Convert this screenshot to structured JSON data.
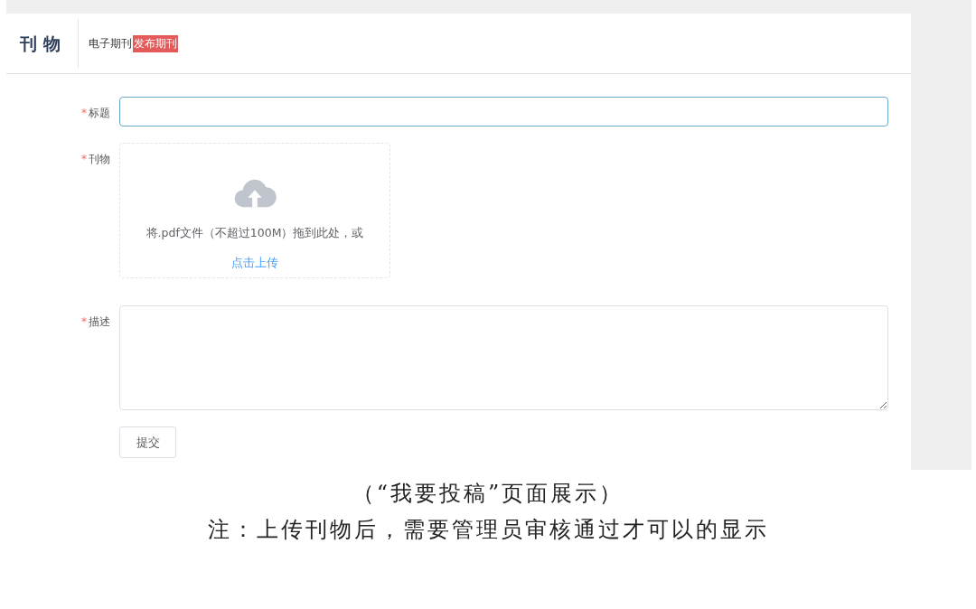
{
  "header": {
    "title": "刊 物",
    "breadcrumb": [
      {
        "label": "电子期刊",
        "highlighted": false
      },
      {
        "label": "发布期刊",
        "highlighted": true
      }
    ]
  },
  "form": {
    "fields": [
      {
        "kind": "input",
        "required_mark": "*",
        "label": "标题",
        "focused": true
      },
      {
        "kind": "upload",
        "required_mark": "*",
        "label": "刊物",
        "hint": "将.pdf文件（不超过100M）拖到此处，或 ",
        "link": "点击上传"
      },
      {
        "kind": "textarea",
        "required_mark": "*",
        "label": "描述",
        "focused": false
      }
    ],
    "submit": "提交"
  },
  "caption": [
    "（“我要投稿”页面展示）",
    "注：上传刊物后，需要管理员审核通过才可以的显示"
  ]
}
